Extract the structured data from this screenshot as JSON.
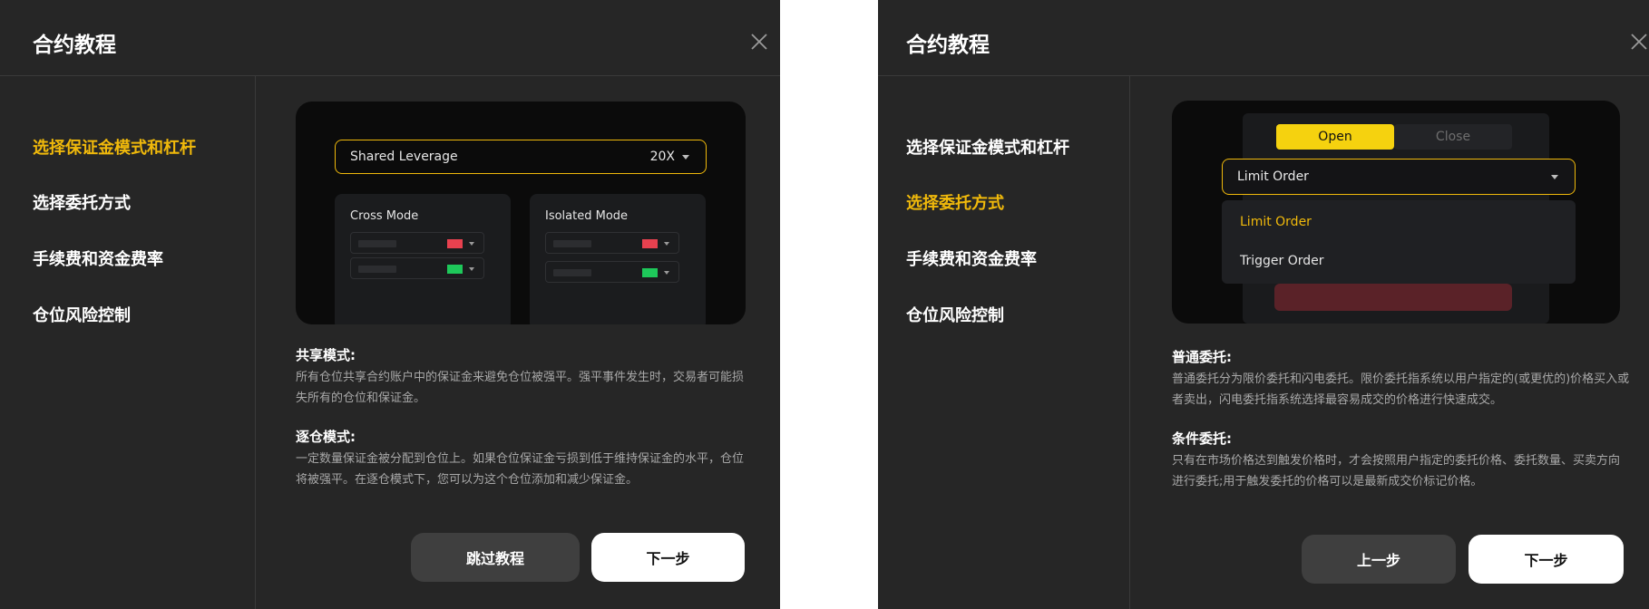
{
  "panel1": {
    "title": "合约教程",
    "nav": [
      "选择保证金模式和杠杆",
      "选择委托方式",
      "手续费和资金费率",
      "仓位风险控制"
    ],
    "active_nav_index": 0,
    "illustration": {
      "leverage_label": "Shared Leverage",
      "leverage_value": "20X",
      "cross_mode": "Cross Mode",
      "isolated_mode": "Isolated Mode"
    },
    "section1": {
      "title": "共享模式:",
      "text": "所有仓位共享合约账户中的保证金来避免仓位被强平。强平事件发生时，交易者可能损失所有的仓位和保证金。"
    },
    "section2": {
      "title": "逐仓模式:",
      "text": "一定数量保证金被分配到仓位上。如果仓位保证金亏损到低于维持保证金的水平，仓位将被强平。在逐仓模式下，您可以为这个仓位添加和减少保证金。"
    },
    "buttons": {
      "skip": "跳过教程",
      "next": "下一步"
    }
  },
  "panel2": {
    "title": "合约教程",
    "nav": [
      "选择保证金模式和杠杆",
      "选择委托方式",
      "手续费和资金费率",
      "仓位风险控制"
    ],
    "active_nav_index": 1,
    "illustration": {
      "tab_open": "Open",
      "tab_close": "Close",
      "order_type_selected": "Limit Order",
      "options": [
        "Limit Order",
        "Trigger Order"
      ]
    },
    "section1": {
      "title": "普通委托:",
      "text": "普通委托分为限价委托和闪电委托。限价委托指系统以用户指定的(或更优的)价格买入或者卖出，闪电委托指系统选择最容易成交的价格进行快速成交。"
    },
    "section2": {
      "title": "条件委托:",
      "text": "只有在市场价格达到触发价格时，才会按照用户指定的委托价格、委托数量、买卖方向进行委托;用于触发委托的价格可以是最新成交价标记价格。"
    },
    "buttons": {
      "prev": "上一步",
      "next": "下一步"
    }
  },
  "colors": {
    "panel_bg": "#262626",
    "accent": "#f0b90b",
    "illustration_bg": "#0b0b0b",
    "flag_red": "#e8414f",
    "flag_green": "#1ec85a"
  },
  "icons": [
    "close-icon",
    "chevron-down-icon"
  ]
}
